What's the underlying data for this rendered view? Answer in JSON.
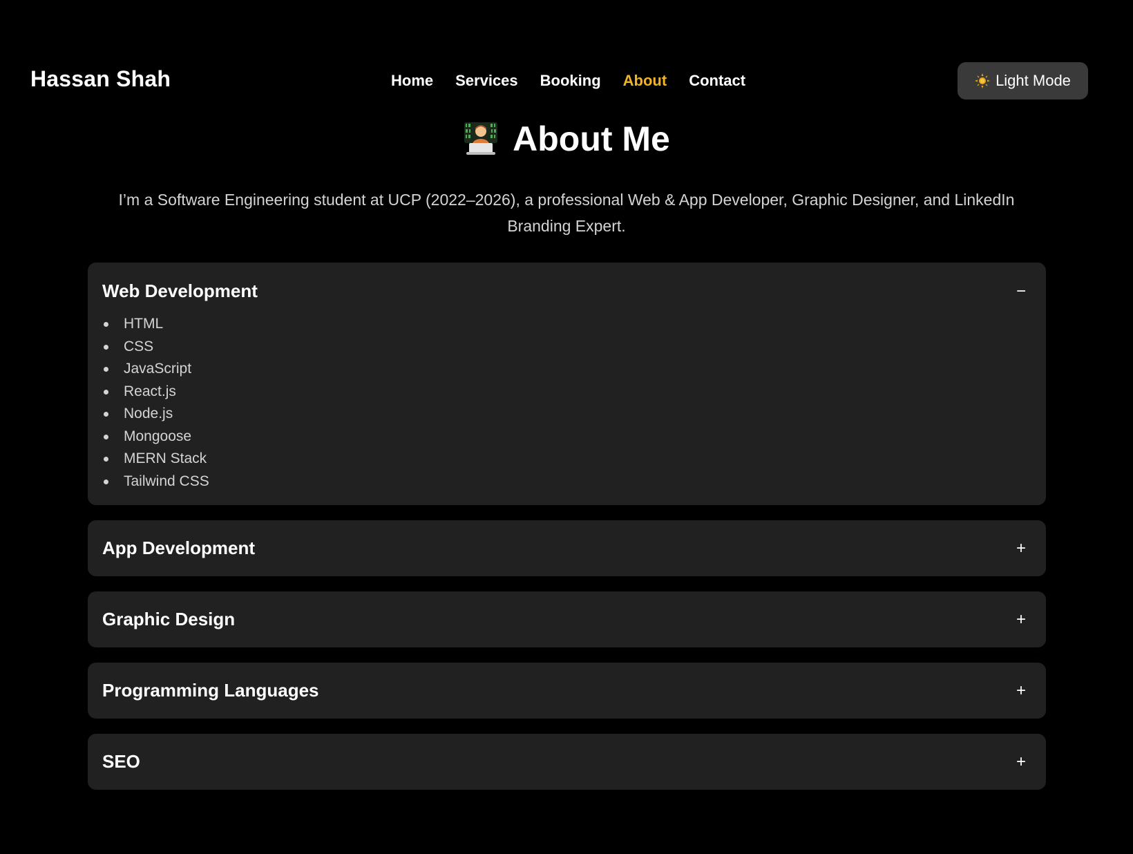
{
  "navbar": {
    "brand": "Hassan Shah",
    "links": [
      {
        "label": "Home",
        "active": false
      },
      {
        "label": "Services",
        "active": false
      },
      {
        "label": "Booking",
        "active": false
      },
      {
        "label": "About",
        "active": true
      },
      {
        "label": "Contact",
        "active": false
      }
    ],
    "theme_toggle": {
      "icon": "sun-icon",
      "label": "Light Mode"
    }
  },
  "colors": {
    "background": "#000000",
    "card": "#212121",
    "accent": "#f0b429",
    "toggle_bg": "#3a3a3a"
  },
  "page": {
    "title_icon": "technologist-icon",
    "title": "About Me",
    "intro": "I’m a Software Engineering student at UCP (2022–2026), a professional Web & App Developer, Graphic Designer, and LinkedIn Branding Expert."
  },
  "accordion": [
    {
      "title": "Web Development",
      "open": true,
      "toggle": "−",
      "items": [
        "HTML",
        "CSS",
        "JavaScript",
        "React.js",
        "Node.js",
        "Mongoose",
        "MERN Stack",
        "Tailwind CSS"
      ]
    },
    {
      "title": "App Development",
      "open": false,
      "toggle": "+",
      "items": []
    },
    {
      "title": "Graphic Design",
      "open": false,
      "toggle": "+",
      "items": []
    },
    {
      "title": "Programming Languages",
      "open": false,
      "toggle": "+",
      "items": []
    },
    {
      "title": "SEO",
      "open": false,
      "toggle": "+",
      "items": []
    }
  ]
}
